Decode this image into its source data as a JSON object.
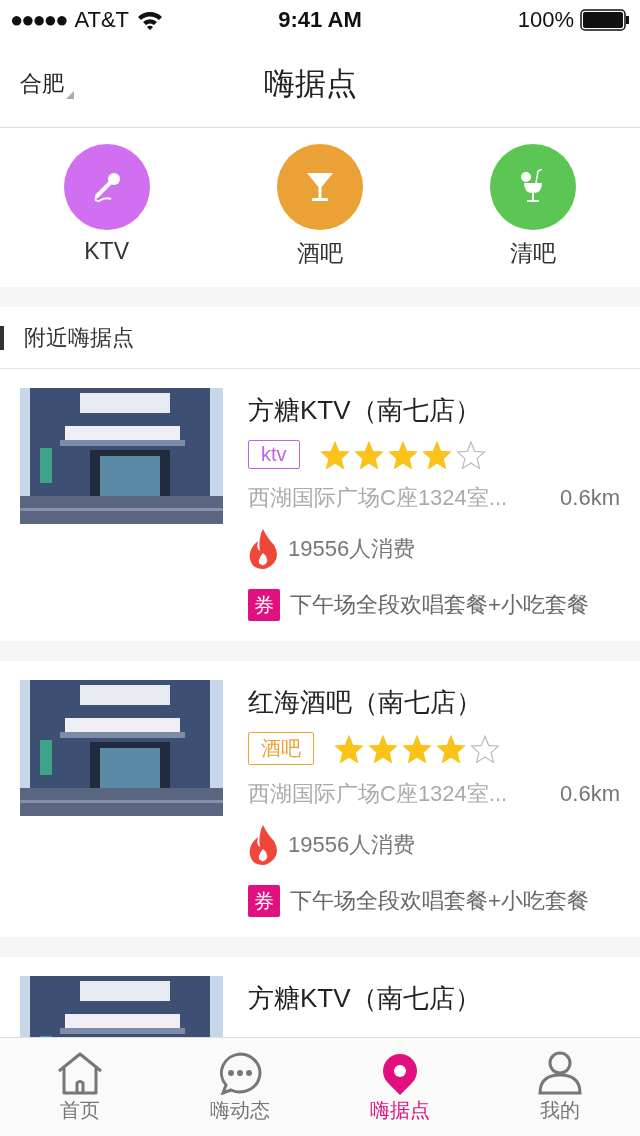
{
  "status_bar": {
    "signal": "●●●●●",
    "carrier": "AT&T",
    "time": "9:41 AM",
    "battery": "100%"
  },
  "nav": {
    "city": "合肥",
    "title": "嗨据点"
  },
  "categories": [
    {
      "kind": "ktv",
      "label": "KTV",
      "color": "#d070f0"
    },
    {
      "kind": "bar",
      "label": "酒吧",
      "color": "#eba135"
    },
    {
      "kind": "lounge",
      "label": "清吧",
      "color": "#5cc654"
    }
  ],
  "section_title": "附近嗨据点",
  "venues": [
    {
      "name": "方糖KTV（南七店）",
      "tag": "ktv",
      "color": "#c061e6",
      "stars": 4,
      "address": "西湖国际广场C座1324室...",
      "distance": "0.6km",
      "consumers": "19556人消费",
      "coupon_badge": "券",
      "coupon": "下午场全段欢唱套餐+小吃套餐"
    },
    {
      "name": "红海酒吧（南七店）",
      "tag": "酒吧",
      "color": "#eba135",
      "stars": 4,
      "address": "西湖国际广场C座1324室...",
      "distance": "0.6km",
      "consumers": "19556人消费",
      "coupon_badge": "券",
      "coupon": "下午场全段欢唱套餐+小吃套餐"
    },
    {
      "name": "方糖KTV（南七店）"
    }
  ],
  "tab_bar": [
    {
      "kind": "home",
      "label": "首页",
      "selected": false
    },
    {
      "kind": "chat",
      "label": "嗨动态",
      "selected": false
    },
    {
      "kind": "pin",
      "label": "嗨据点",
      "selected": true
    },
    {
      "kind": "person",
      "label": "我的",
      "selected": false
    }
  ]
}
